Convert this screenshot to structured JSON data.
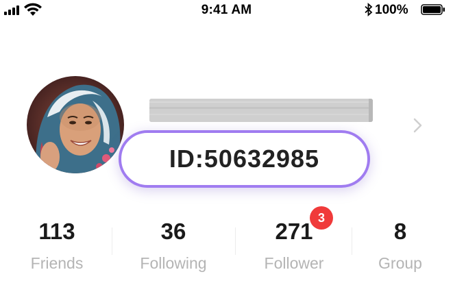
{
  "status_bar": {
    "time": "9:41 AM",
    "battery_percent": "100%",
    "signal_bars": 4,
    "icons": [
      "signal-icon",
      "wifi-icon",
      "bluetooth-icon",
      "battery-icon"
    ]
  },
  "profile": {
    "avatar_icon": "avatar",
    "id_label": "ID:50632985",
    "chevron_icon": "chevron-right-icon"
  },
  "stats": [
    {
      "value": "113",
      "label": "Friends"
    },
    {
      "value": "36",
      "label": "Following"
    },
    {
      "value": "271",
      "label": "Follower",
      "badge": "3"
    },
    {
      "value": "8",
      "label": "Group"
    }
  ],
  "colors": {
    "accent_border": "#a07cf0",
    "badge": "#f03a3a",
    "label_gray": "#b4b4b4",
    "redacted_bar": "#cfcfcf"
  }
}
